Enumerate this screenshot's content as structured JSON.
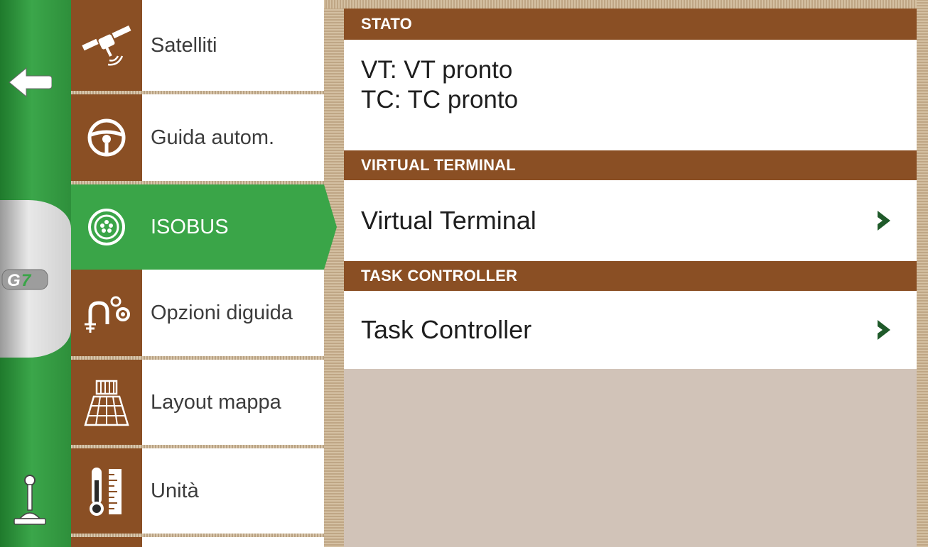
{
  "menu": {
    "items": [
      {
        "label": "Satelliti",
        "icon": "satellite-icon",
        "active": false
      },
      {
        "label": "Guida autom.",
        "icon": "steering-wheel-icon",
        "active": false
      },
      {
        "label": "ISOBUS",
        "icon": "isobus-connector-icon",
        "active": true
      },
      {
        "label": "Opzioni di guida",
        "label_lines": [
          "Opzioni di",
          "guida"
        ],
        "icon": "guidance-options-icon",
        "active": false
      },
      {
        "label": "Layout mappa",
        "icon": "map-grid-icon",
        "active": false
      },
      {
        "label": "Unità",
        "icon": "thermometer-ruler-icon",
        "active": false
      }
    ]
  },
  "rail": {
    "back_icon": "back-arrow-icon",
    "brand": "G7",
    "bottom_icon": "joystick-icon"
  },
  "panel": {
    "stato": {
      "header": "STATO",
      "vt_status": "VT: VT pronto",
      "tc_status": "TC: TC pronto"
    },
    "virtual_terminal": {
      "header": "VIRTUAL TERMINAL",
      "row_label": "Virtual Terminal",
      "row_icon": "chevron-right-icon"
    },
    "task_controller": {
      "header": "TASK CONTROLLER",
      "row_label": "Task Controller",
      "row_icon": "chevron-right-icon"
    }
  },
  "colors": {
    "brown": "#8a4f24",
    "green": "#3aa548",
    "panel_bg": "#d1c3b8",
    "chevron": "#1f5a2a"
  }
}
